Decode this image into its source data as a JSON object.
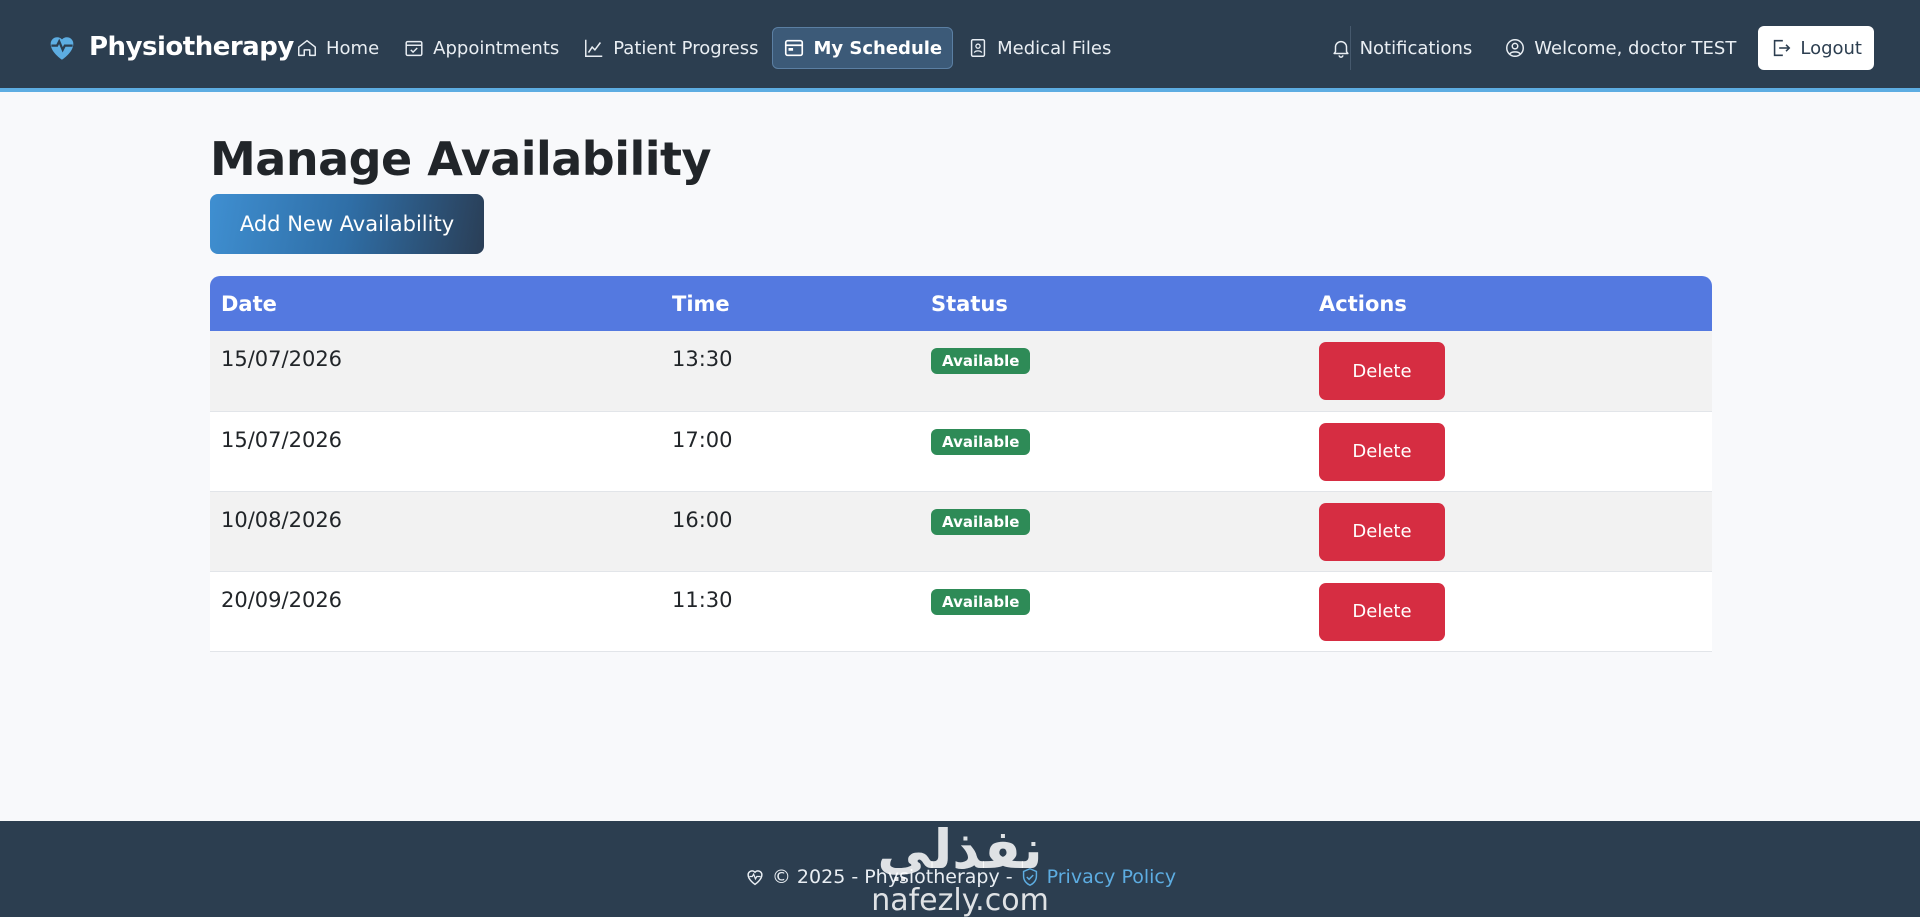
{
  "nav": {
    "brand": "Physiotherapy",
    "links": [
      {
        "label": "Home"
      },
      {
        "label": "Appointments"
      },
      {
        "label": "Patient Progress"
      },
      {
        "label": "My Schedule"
      },
      {
        "label": "Medical Files"
      }
    ],
    "notifications": "Notifications",
    "welcome": "Welcome, doctor TEST",
    "logout": "Logout"
  },
  "page": {
    "title": "Manage Availability",
    "add_button": "Add New Availability"
  },
  "table": {
    "headers": [
      "Date",
      "Time",
      "Status",
      "Actions"
    ],
    "rows": [
      {
        "date": "15/07/2026",
        "time": "13:30",
        "status": "Available",
        "action": "Delete"
      },
      {
        "date": "15/07/2026",
        "time": "17:00",
        "status": "Available",
        "action": "Delete"
      },
      {
        "date": "10/08/2026",
        "time": "16:00",
        "status": "Available",
        "action": "Delete"
      },
      {
        "date": "20/09/2026",
        "time": "11:30",
        "status": "Available",
        "action": "Delete"
      }
    ]
  },
  "footer": {
    "copyright": "© 2025 - Physiotherapy -",
    "privacy": "Privacy Policy"
  },
  "watermark": {
    "arabic": "نفذلي",
    "latin": "nafezly.com"
  },
  "colors": {
    "navbar": "#2c3e50",
    "accent_border": "#5dade2",
    "table_header": "#5479e0",
    "badge_green": "#2e8b57",
    "delete_red": "#d62d42"
  }
}
